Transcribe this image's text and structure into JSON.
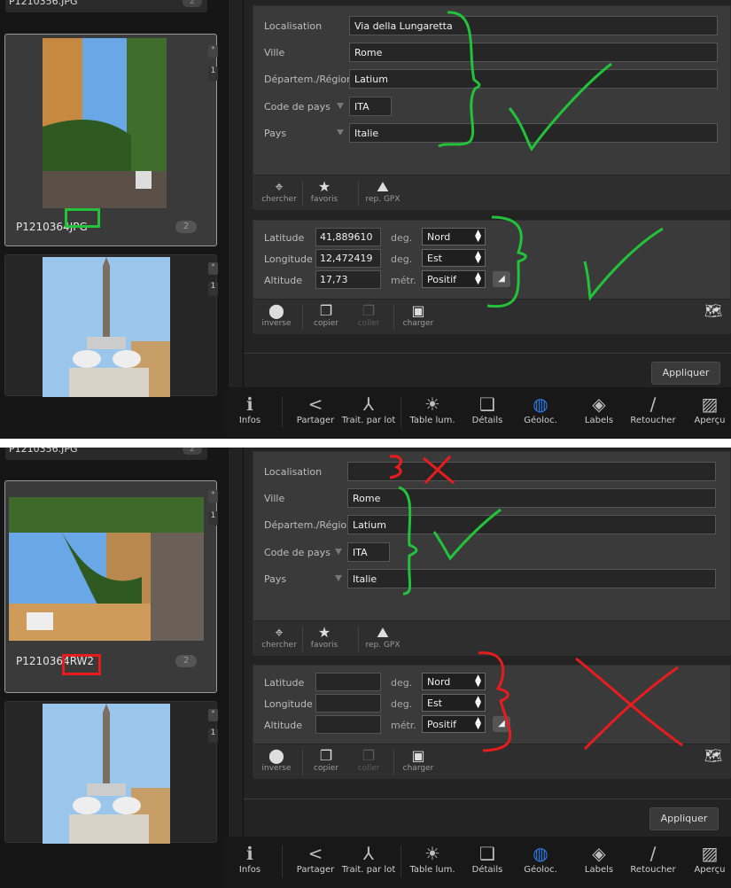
{
  "screens": [
    {
      "film": {
        "prev_label": "P1210356.JPG",
        "prev_count": "2",
        "selected": {
          "name_prefix": "P1210364",
          "ext": "JPG",
          "count": "2",
          "tab_star": "*",
          "tab_num": "1"
        },
        "next": {
          "tab_star": "*",
          "tab_num": "1"
        }
      },
      "location": {
        "localisation_label": "Localisation",
        "localisation_value": "Via della Lungaretta",
        "ville_label": "Ville",
        "ville_value": "Rome",
        "region_label": "Départem./Région",
        "region_value": "Latium",
        "code_label": "Code de pays",
        "code_value": "ITA",
        "pays_label": "Pays",
        "pays_value": "Italie"
      },
      "loc_tools": {
        "chercher": "chercher",
        "favoris": "favoris",
        "gpx": "rep. GPX"
      },
      "gps": {
        "lat_label": "Latitude",
        "lat_value": "41,889610",
        "lat_unit": "deg.",
        "lat_dir": "Nord",
        "lon_label": "Longitude",
        "lon_value": "12,472419",
        "lon_unit": "deg.",
        "lon_dir": "Est",
        "alt_label": "Altitude",
        "alt_value": "17,73",
        "alt_unit": "métr.",
        "alt_dir": "Positif"
      },
      "gps_tools": {
        "inverse": "inverse",
        "copier": "copier",
        "coller": "coller",
        "charger": "charger"
      },
      "apply": "Appliquer"
    },
    {
      "film": {
        "prev_label": "P1210356.JPG",
        "prev_count": "2",
        "selected": {
          "name_prefix": "P1210364",
          "ext": "RW2",
          "count": "2",
          "tab_star": "*",
          "tab_num": "1"
        },
        "next": {
          "tab_star": "*",
          "tab_num": "1"
        }
      },
      "location": {
        "localisation_label": "Localisation",
        "localisation_value": "",
        "ville_label": "Ville",
        "ville_value": "Rome",
        "region_label": "Départem./Région",
        "region_value": "Latium",
        "code_label": "Code de pays",
        "code_value": "ITA",
        "pays_label": "Pays",
        "pays_value": "Italie"
      },
      "loc_tools": {
        "chercher": "chercher",
        "favoris": "favoris",
        "gpx": "rep. GPX"
      },
      "gps": {
        "lat_label": "Latitude",
        "lat_value": "",
        "lat_unit": "deg.",
        "lat_dir": "Nord",
        "lon_label": "Longitude",
        "lon_value": "",
        "lon_unit": "deg.",
        "lon_dir": "Est",
        "alt_label": "Altitude",
        "alt_value": "",
        "alt_unit": "métr.",
        "alt_dir": "Positif"
      },
      "gps_tools": {
        "inverse": "inverse",
        "copier": "copier",
        "coller": "coller",
        "charger": "charger"
      },
      "apply": "Appliquer"
    }
  ],
  "bottom_tabs": [
    "Infos",
    "Partager",
    "Trait. par lot",
    "Table lum.",
    "Détails",
    "Géoloc.",
    "Labels",
    "Retoucher",
    "Aperçu"
  ],
  "colors": {
    "ok_annotation": "#22c23a",
    "fail_annotation": "#e81c1c",
    "active_tab": "#2b7de9"
  }
}
